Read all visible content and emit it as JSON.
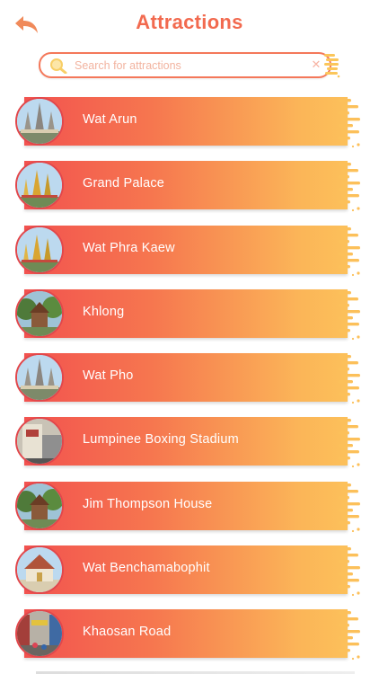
{
  "header": {
    "title": "Attractions",
    "back_icon": "back-arrow-icon",
    "accent_color": "#f26a4f"
  },
  "search": {
    "placeholder": "Search for attractions",
    "value": "",
    "search_icon": "search-icon",
    "clear_icon": "close-icon",
    "clear_glyph": "✕"
  },
  "attractions": [
    {
      "name": "Wat Arun",
      "thumb": "temple-spires"
    },
    {
      "name": "Grand Palace",
      "thumb": "golden-stupa"
    },
    {
      "name": "Wat Phra Kaew",
      "thumb": "golden-stupa"
    },
    {
      "name": "Khlong",
      "thumb": "trees-house"
    },
    {
      "name": "Wat Pho",
      "thumb": "temple-spires"
    },
    {
      "name": "Lumpinee Boxing Stadium",
      "thumb": "stadium"
    },
    {
      "name": "Jim Thompson House",
      "thumb": "trees-house"
    },
    {
      "name": "Wat Benchamabophit",
      "thumb": "temple-hall"
    },
    {
      "name": "Khaosan Road",
      "thumb": "street"
    }
  ],
  "colors": {
    "gradient_start": "#f2524f",
    "gradient_end": "#fcc05a",
    "thumb_border": "#e2474b"
  }
}
